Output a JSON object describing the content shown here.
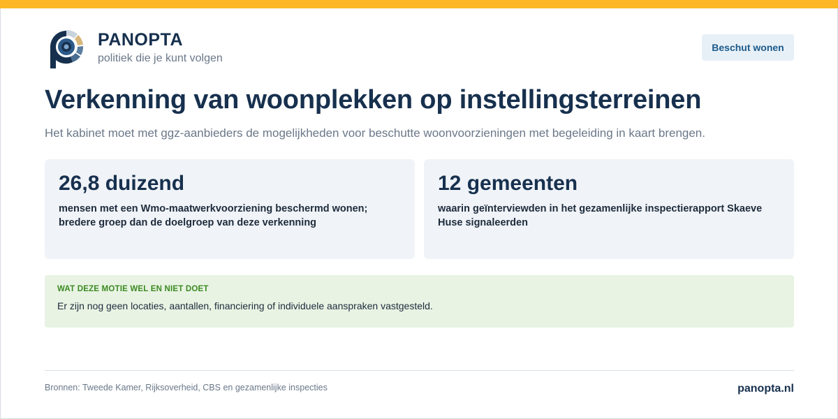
{
  "brand": {
    "name": "PANOPTA",
    "tagline": "politiek die je kunt volgen",
    "logo_icon": "panopta-eye-logo-icon",
    "accent_color": "#fbb824"
  },
  "topic_badge": "Beschut wonen",
  "headline": "Verkenning van woonplekken op instellingsterreinen",
  "subtitle": "Het kabinet moet met ggz-aanbieders de mogelijkheden voor beschutte woonvoorzieningen met begeleiding in kaart brengen.",
  "stats": [
    {
      "value": "26,8 duizend",
      "description": "mensen met een Wmo-maatwerkvoorziening beschermd wonen; bredere groep dan de doelgroep van deze verkenning"
    },
    {
      "value": "12 gemeenten",
      "description": "waarin geïnterviewden in het gezamenlijke inspectierapport Skaeve Huse signaleerden"
    }
  ],
  "info": {
    "title": "WAT DEZE MOTIE WEL EN NIET DOET",
    "text": "Er zijn nog geen locaties, aantallen, financiering of individuele aanspraken vastgesteld."
  },
  "footer": {
    "sources": "Bronnen: Tweede Kamer, Rijksoverheid, CBS en gezamenlijke inspecties",
    "url": "panopta.nl"
  }
}
